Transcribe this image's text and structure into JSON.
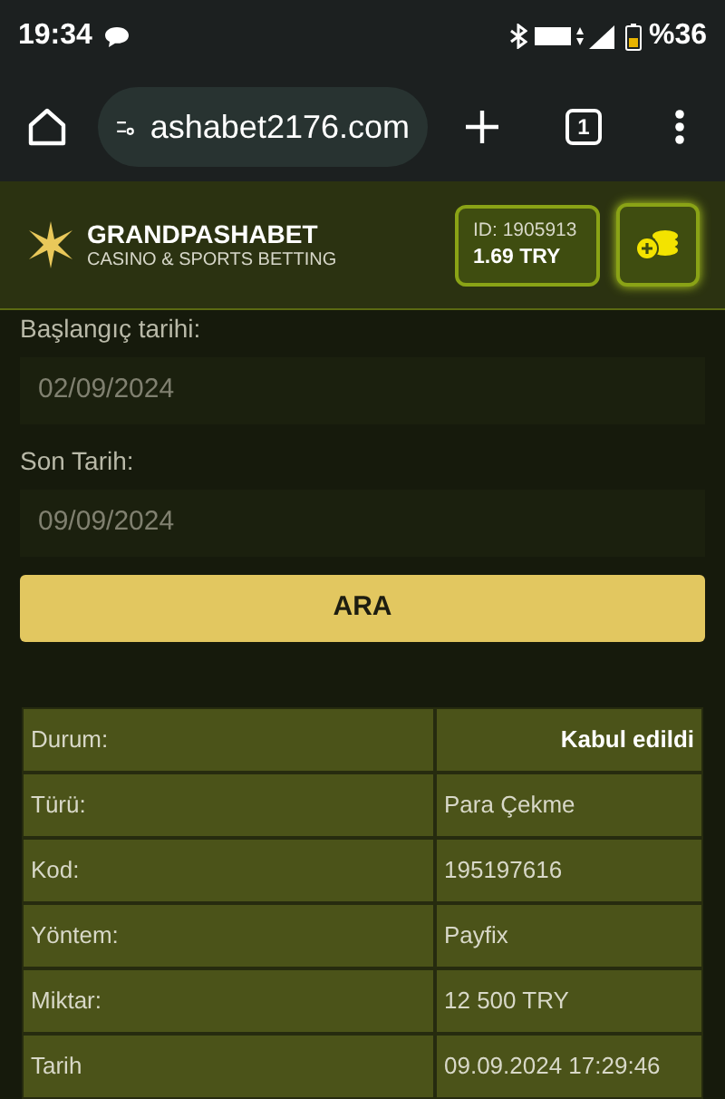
{
  "status_bar": {
    "time": "19:34",
    "battery": "%36"
  },
  "browser": {
    "url": "ashabet2176.com",
    "tab_count": "1"
  },
  "header": {
    "brand": "GRANDPASHABET",
    "tagline": "CASINO & SPORTS BETTING",
    "account_id": "ID: 1905913",
    "balance": "1.69 TRY"
  },
  "form": {
    "fields": [
      {
        "label": "Başlangıç tarihi:",
        "value": "02/09/2024"
      },
      {
        "label": "Son Tarih:",
        "value": "09/09/2024"
      }
    ],
    "search_button": "ARA"
  },
  "details": [
    {
      "label": "Durum:",
      "value": "Kabul edildi",
      "kind": "status"
    },
    {
      "label": "Türü:",
      "value": "Para Çekme",
      "kind": "plain"
    },
    {
      "label": "Kod:",
      "value": "195197616",
      "kind": "plain"
    },
    {
      "label": "Yöntem:",
      "value": "Payfix",
      "kind": "plain"
    },
    {
      "label": "Miktar:",
      "value": "12 500 TRY",
      "kind": "plain"
    },
    {
      "label": "Tarih",
      "value": "09.09.2024 17:29:46",
      "kind": "plain"
    }
  ]
}
